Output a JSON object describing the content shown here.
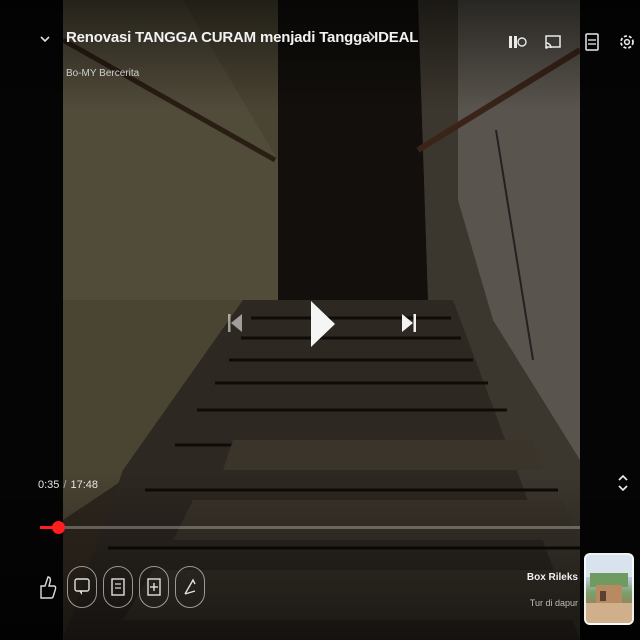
{
  "video": {
    "title": "Renovasi TANGGA CURAM menjadi Tangga IDEAL",
    "channel": "Bo-MY Bercerita"
  },
  "icons": {
    "collapse": "chevron-down-icon",
    "title_more": "chevron-right-icon",
    "pause_top": "pause-icon",
    "cast": "cast-icon",
    "captions": "captions-icon",
    "settings": "settings-gear-icon",
    "previous": "skip-previous-icon",
    "play": "play-icon",
    "next": "skip-next-icon",
    "fullscreen": "fullscreen-icon",
    "like": "thumbs-up-icon",
    "comment": "comment-icon",
    "save": "save-to-playlist-icon",
    "add": "add-icon",
    "share": "share-icon"
  },
  "playback": {
    "current_time": "0:35",
    "duration": "17:48",
    "progress_fraction": 0.033
  },
  "up_next": {
    "title": "Box Rileks",
    "subtitle": "Tur di dapur"
  },
  "colors": {
    "accent": "#ff1d1d"
  }
}
